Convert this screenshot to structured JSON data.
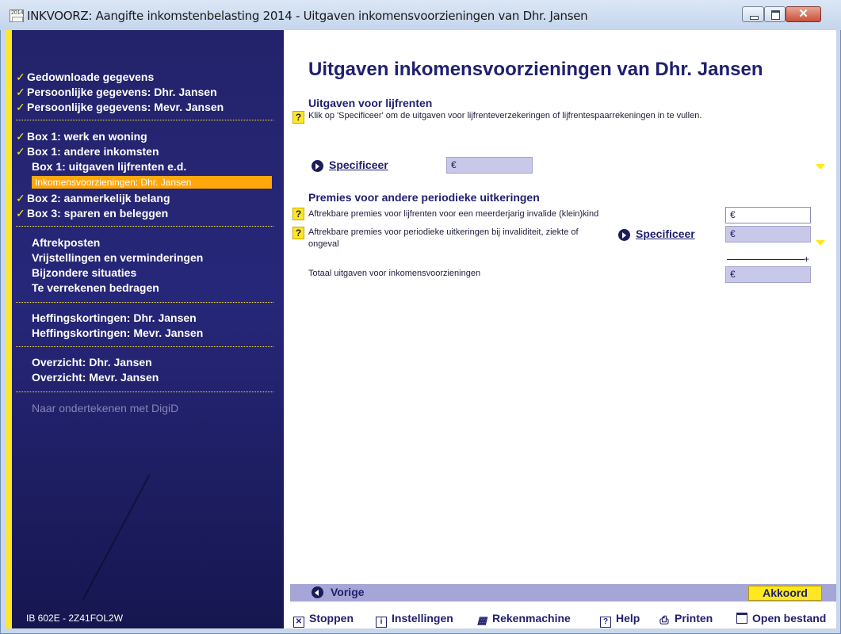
{
  "window": {
    "icon_text": "2014",
    "title": "INKVOORZ: Aangifte inkomstenbelasting 2014 - Uitgaven inkomensvoorzieningen van Dhr. Jansen"
  },
  "sidebar": {
    "items": [
      {
        "label": "Gedownloade gegevens",
        "check": "✓"
      },
      {
        "label": "Persoonlijke gegevens: Dhr. Jansen",
        "check": "✓"
      },
      {
        "label": "Persoonlijke gegevens: Mevr. Jansen",
        "check": "✓"
      },
      {
        "label": "Box 1: werk en woning",
        "check": "✓"
      },
      {
        "label": "Box 1: andere inkomsten",
        "check": "✓"
      },
      {
        "label": "Box 1: uitgaven lijfrenten e.d."
      },
      {
        "label": "Inkomensvoorzieningen: Dhr. Jansen"
      },
      {
        "label": "Box 2: aanmerkelijk belang",
        "check": "✓"
      },
      {
        "label": "Box 3: sparen en beleggen",
        "check": "✓"
      },
      {
        "label": "Aftrekposten"
      },
      {
        "label": "Vrijstellingen en verminderingen"
      },
      {
        "label": "Bijzondere situaties"
      },
      {
        "label": "Te verrekenen bedragen"
      },
      {
        "label": "Heffingskortingen: Dhr. Jansen"
      },
      {
        "label": "Heffingskortingen: Mevr. Jansen"
      },
      {
        "label": "Overzicht: Dhr. Jansen"
      },
      {
        "label": "Overzicht: Mevr. Jansen"
      },
      {
        "label": "Naar ondertekenen met DigiD"
      }
    ],
    "code": "IB 602E - 2Z41FOL2W"
  },
  "main": {
    "title": "Uitgaven inkomensvoorzieningen van Dhr. Jansen",
    "section1": {
      "title": "Uitgaven voor lijfrenten",
      "help": "?",
      "description": "Klik op 'Specificeer' om de uitgaven voor lijfrenteverzekeringen of lijfrentespaarrekeningen in te vullen.",
      "specify_label": "Specificeer",
      "amount": "€"
    },
    "section2": {
      "title": "Premies voor andere periodieke uitkeringen",
      "row1": {
        "help": "?",
        "label": "Aftrekbare premies voor lijfrenten voor een meerderjarig invalide (klein)kind",
        "amount": "€"
      },
      "row2": {
        "help": "?",
        "label": "Aftrekbare premies voor periodieke uitkeringen bij invaliditeit, ziekte of ongeval",
        "specify_label": "Specificeer",
        "amount": "€"
      },
      "sum_sign": "+",
      "total_label": "Totaal uitgaven voor inkomensvoorzieningen",
      "total_amount": "€"
    }
  },
  "navigation": {
    "previous": "Vorige",
    "accept": "Akkoord"
  },
  "toolbar": {
    "stop": "Stoppen",
    "settings": "Instellingen",
    "calculator": "Rekenmachine",
    "help": "Help",
    "print": "Printen",
    "open_file": "Open bestand"
  }
}
